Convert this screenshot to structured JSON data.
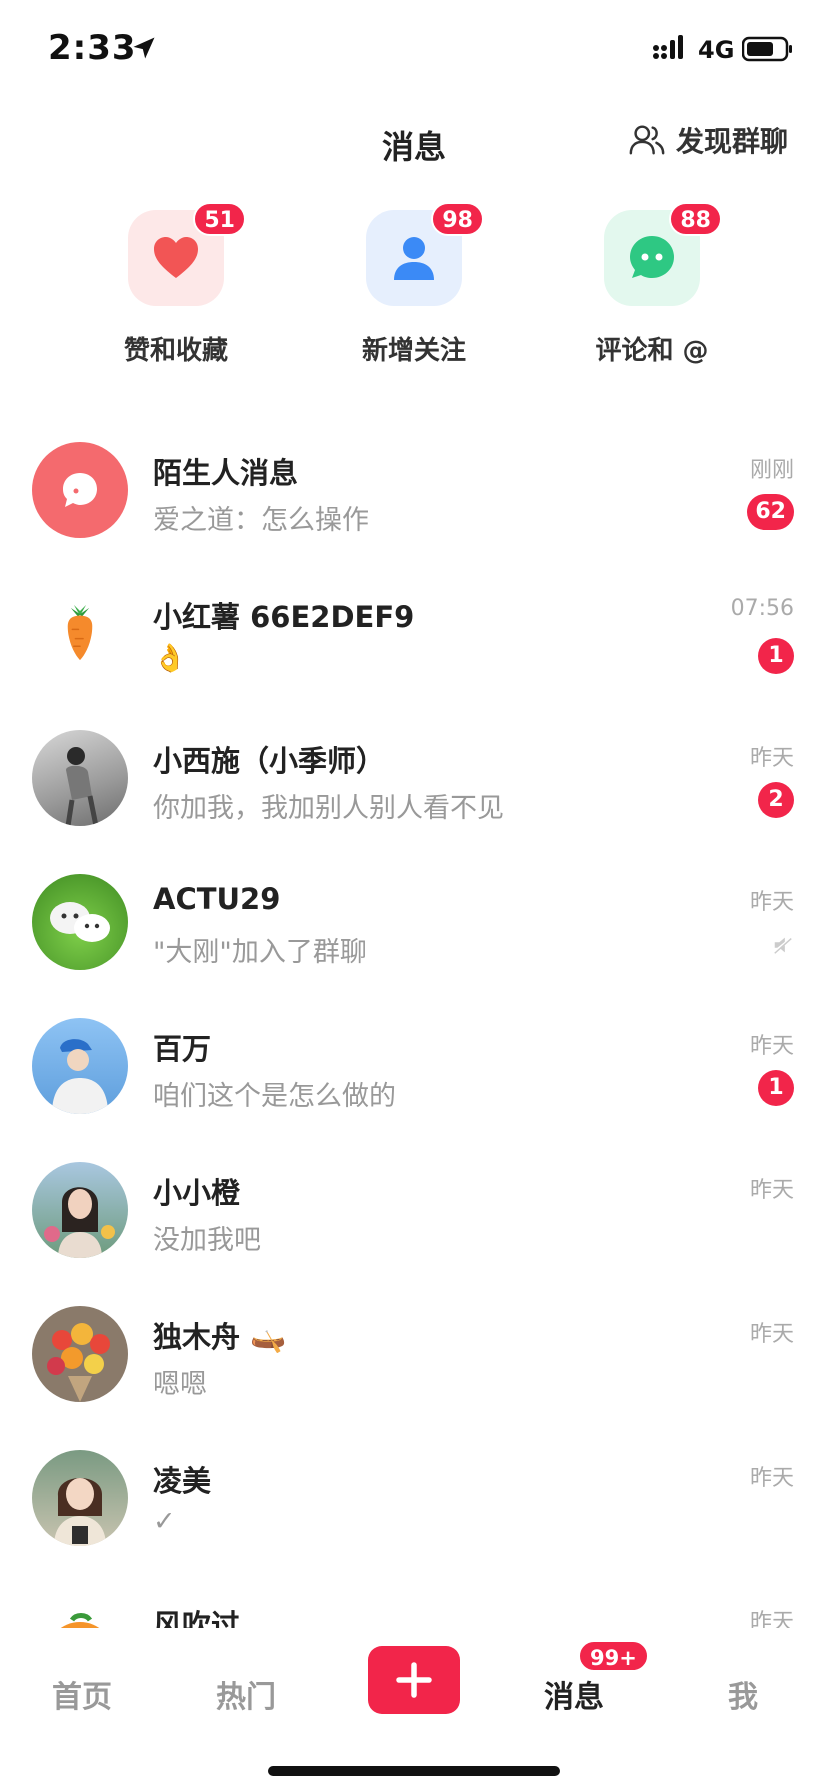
{
  "status_bar": {
    "time": "2:33",
    "network": "4G"
  },
  "header": {
    "title": "消息",
    "discover_label": "发现群聊"
  },
  "quick_actions": [
    {
      "label": "赞和收藏",
      "badge": "51",
      "icon": "heart-icon",
      "color": "#f25555",
      "tile_bg": "#fde8e8"
    },
    {
      "label": "新增关注",
      "badge": "98",
      "icon": "person-icon",
      "color": "#3b8af6",
      "tile_bg": "#e6effd"
    },
    {
      "label": "评论和 @",
      "badge": "88",
      "icon": "comment-icon",
      "color": "#2ec883",
      "tile_bg": "#e3f8ee"
    }
  ],
  "conversations": [
    {
      "name": "陌生人消息",
      "preview": "爱之道：怎么操作",
      "time": "刚刚",
      "badge": "62"
    },
    {
      "name": "小红薯 66E2DEF9",
      "preview": "👌",
      "time": "07:56",
      "badge": "1"
    },
    {
      "name": "小西施（小季师）",
      "preview": "你加我，我加别人别人看不见",
      "time": "昨天",
      "badge": "2"
    },
    {
      "name": "ACTU29",
      "preview": "\"大刚\"加入了群聊",
      "time": "昨天",
      "badge": ""
    },
    {
      "name": "百万",
      "preview": "咱们这个是怎么做的",
      "time": "昨天",
      "badge": "1"
    },
    {
      "name": "小小橙",
      "preview": "没加我吧",
      "time": "昨天",
      "badge": ""
    },
    {
      "name": "独木舟 🛶",
      "preview": "嗯嗯",
      "time": "昨天",
      "badge": ""
    },
    {
      "name": "凌美",
      "preview": "✓",
      "time": "昨天",
      "badge": ""
    },
    {
      "name": "风吹过",
      "preview": "",
      "time": "昨天",
      "badge": ""
    }
  ],
  "tab_bar": {
    "home": "首页",
    "hot": "热门",
    "messages": "消息",
    "messages_badge": "99+",
    "me": "我"
  },
  "colors": {
    "accent": "#f2254a"
  }
}
